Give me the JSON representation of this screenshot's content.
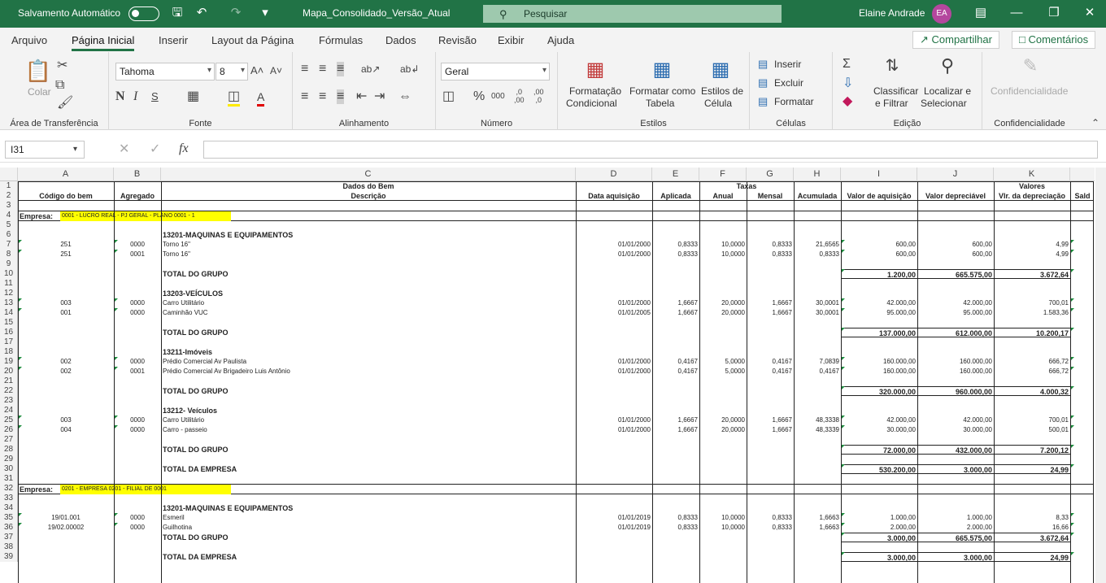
{
  "titlebar": {
    "autosave_label": "Salvamento Automático",
    "doc_title": "Mapa_Consolidado_Versão_Atual",
    "search_placeholder": "Pesquisar",
    "user_name": "Elaine Andrade",
    "user_initials": "EA"
  },
  "menu": {
    "tabs": [
      "Arquivo",
      "Página Inicial",
      "Inserir",
      "Layout da Página",
      "Fórmulas",
      "Dados",
      "Revisão",
      "Exibir",
      "Ajuda"
    ],
    "share": "Compartilhar",
    "comments": "Comentários"
  },
  "ribbon": {
    "clipboard": {
      "paste": "Colar",
      "label": "Área de Transferência"
    },
    "font": {
      "name": "Tahoma",
      "size": "8",
      "label": "Fonte"
    },
    "alignment": {
      "label": "Alinhamento"
    },
    "number": {
      "format": "Geral",
      "label": "Número"
    },
    "styles": {
      "cond1": "Formatação",
      "cond2": "Condicional",
      "table1": "Formatar como",
      "table2": "Tabela",
      "cell1": "Estilos de",
      "cell2": "Célula",
      "label": "Estilos"
    },
    "cells": {
      "insert": "Inserir",
      "delete": "Excluir",
      "format": "Formatar",
      "label": "Células"
    },
    "editing": {
      "sort1": "Classificar",
      "sort2": "e Filtrar",
      "find1": "Localizar e",
      "find2": "Selecionar",
      "label": "Edição"
    },
    "conf": {
      "btn": "Confidencialidade",
      "label": "Confidencialidade"
    }
  },
  "formula_bar": {
    "name_box": "I31",
    "formula": ""
  },
  "columns": [
    "A",
    "B",
    "C",
    "D",
    "E",
    "F",
    "G",
    "H",
    "I",
    "J",
    "K"
  ],
  "header1": {
    "dados": "Dados do Bem",
    "taxas": "Taxas",
    "valores": "Valores"
  },
  "header2": [
    "Código do bem",
    "Agregado",
    "Descrição",
    "Data aquisição",
    "Aplicada",
    "Anual",
    "Mensal",
    "Acumulada",
    "Valor de aquisição",
    "Valor depreciável",
    "Vlr. da depreciação",
    "Sald"
  ],
  "sheet_rows": [
    {
      "r": "1"
    },
    {
      "r": "2"
    },
    {
      "r": "3"
    },
    {
      "r": "4",
      "empresa": "Empresa:",
      "empresa_val": "0001 - LUCRO REAL - PJ GERAL - PLANO 0001 - 1"
    },
    {
      "r": "5"
    },
    {
      "r": "6",
      "group": "13201-MAQUINAS E EQUIPAMENTOS"
    },
    {
      "r": "7",
      "cells": [
        "251",
        "0000",
        "Torno 16\"",
        "01/01/2000",
        "0,8333",
        "10,0000",
        "0,8333",
        "21,6565",
        "600,00",
        "600,00",
        "4,99"
      ]
    },
    {
      "r": "8",
      "cells": [
        "251",
        "0001",
        "Torno 16\"",
        "01/01/2000",
        "0,8333",
        "10,0000",
        "0,8333",
        "0,8333",
        "600,00",
        "600,00",
        "4,99"
      ]
    },
    {
      "r": "9"
    },
    {
      "r": "10",
      "total": "TOTAL DO GRUPO",
      "tv": [
        "1.200,00",
        "665.575,00",
        "3.672,64"
      ]
    },
    {
      "r": "11"
    },
    {
      "r": "12",
      "group": "13203-VEÍCULOS"
    },
    {
      "r": "13",
      "cells": [
        "003",
        "0000",
        "Carro Utilitário",
        "01/01/2000",
        "1,6667",
        "20,0000",
        "1,6667",
        "30,0001",
        "42.000,00",
        "42.000,00",
        "700,01"
      ]
    },
    {
      "r": "14",
      "cells": [
        "001",
        "0000",
        "Caminhão VUC",
        "01/01/2005",
        "1,6667",
        "20,0000",
        "1,6667",
        "30,0001",
        "95.000,00",
        "95.000,00",
        "1.583,36"
      ]
    },
    {
      "r": "15"
    },
    {
      "r": "16",
      "total": "TOTAL DO GRUPO",
      "tv": [
        "137.000,00",
        "612.000,00",
        "10.200,17"
      ]
    },
    {
      "r": "17"
    },
    {
      "r": "18",
      "group": "13211-Imóveis"
    },
    {
      "r": "19",
      "cells": [
        "002",
        "0000",
        "Prédio Comercial Av Paulista",
        "01/01/2000",
        "0,4167",
        "5,0000",
        "0,4167",
        "7,0839",
        "160.000,00",
        "160.000,00",
        "666,72"
      ]
    },
    {
      "r": "20",
      "cells": [
        "002",
        "0001",
        "Prédio Comercial Av Brigadeiro Luis Antônio",
        "01/01/2000",
        "0,4167",
        "5,0000",
        "0,4167",
        "0,4167",
        "160.000,00",
        "160.000,00",
        "666,72"
      ]
    },
    {
      "r": "21"
    },
    {
      "r": "22",
      "total": "TOTAL DO GRUPO",
      "tv": [
        "320.000,00",
        "960.000,00",
        "4.000,32"
      ]
    },
    {
      "r": "23"
    },
    {
      "r": "24",
      "group": "13212- Veículos"
    },
    {
      "r": "25",
      "cells": [
        "003",
        "0000",
        "Carro Utilitário",
        "01/01/2000",
        "1,6667",
        "20,0000",
        "1,6667",
        "48,3338",
        "42.000,00",
        "42.000,00",
        "700,01"
      ]
    },
    {
      "r": "26",
      "cells": [
        "004",
        "0000",
        "Carro - passeio",
        "01/01/2000",
        "1,6667",
        "20,0000",
        "1,6667",
        "48,3339",
        "30.000,00",
        "30.000,00",
        "500,01"
      ]
    },
    {
      "r": "27"
    },
    {
      "r": "28",
      "total": "TOTAL DO GRUPO",
      "tv": [
        "72.000,00",
        "432.000,00",
        "7.200,12"
      ]
    },
    {
      "r": "29"
    },
    {
      "r": "30",
      "total": "TOTAL DA EMPRESA",
      "tv": [
        "530.200,00",
        "3.000,00",
        "24,99"
      ]
    },
    {
      "r": "31"
    },
    {
      "r": "32",
      "empresa": "Empresa:",
      "empresa_val": "0201 - EMPRESA 0201 - FILIAL DE 0001"
    },
    {
      "r": "33"
    },
    {
      "r": "34",
      "group": "13201-MAQUINAS E EQUIPAMENTOS"
    },
    {
      "r": "35",
      "cells": [
        "19/01.001",
        "0000",
        "Esmeril",
        "01/01/2019",
        "0,8333",
        "10,0000",
        "0,8333",
        "1,6663",
        "1.000,00",
        "1.000,00",
        "8,33"
      ]
    },
    {
      "r": "36",
      "cells": [
        "19/02.00002",
        "0000",
        "Guilhotina",
        "01/01/2019",
        "0,8333",
        "10,0000",
        "0,8333",
        "1,6663",
        "2.000,00",
        "2.000,00",
        "16,66"
      ]
    },
    {
      "r": "37",
      "total": "TOTAL DO GRUPO",
      "tv": [
        "3.000,00",
        "665.575,00",
        "3.672,64"
      ]
    },
    {
      "r": "38"
    },
    {
      "r": "39",
      "total": "TOTAL DA EMPRESA",
      "tv": [
        "3.000,00",
        "3.000,00",
        "24,99"
      ]
    }
  ]
}
